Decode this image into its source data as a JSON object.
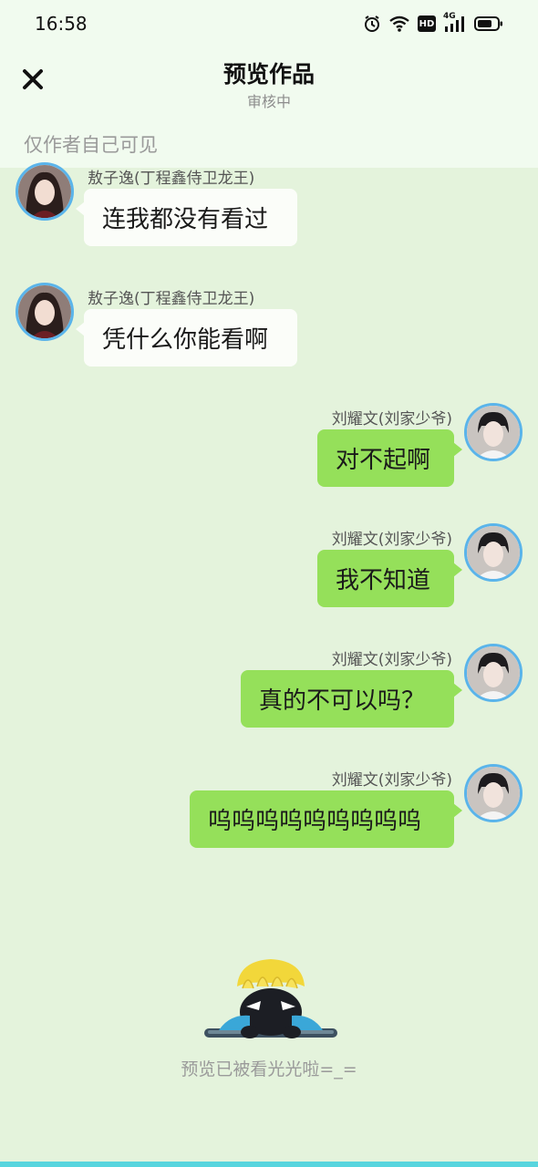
{
  "status_bar": {
    "time": "16:58",
    "icons": [
      "alarm-icon",
      "wifi-icon",
      "hd-icon",
      "signal-4g-icon",
      "battery-icon"
    ],
    "hd_label": "HD",
    "network_label": "4G"
  },
  "header": {
    "title": "预览作品",
    "subtitle": "审核中",
    "close_icon": "close-icon"
  },
  "visibility_note": "仅作者自己可见",
  "messages": [
    {
      "side": "left",
      "sender": "敖子逸(丁程鑫侍卫龙王)",
      "text": "连我都没有看过"
    },
    {
      "side": "left",
      "sender": "敖子逸(丁程鑫侍卫龙王)",
      "text": "凭什么你能看啊"
    },
    {
      "side": "right",
      "sender": "刘耀文(刘家少爷)",
      "text": "对不起啊"
    },
    {
      "side": "right",
      "sender": "刘耀文(刘家少爷)",
      "text": "我不知道"
    },
    {
      "side": "right",
      "sender": "刘耀文(刘家少爷)",
      "text": "真的不可以吗？"
    },
    {
      "side": "right",
      "sender": "刘耀文(刘家少爷)",
      "text": "呜呜呜呜呜呜呜呜呜"
    }
  ],
  "footer": {
    "end_text": "预览已被看光光啦=_="
  },
  "colors": {
    "background": "#e4f3dc",
    "header_bg": "#f1fbef",
    "left_bubble": "#fbfdf9",
    "right_bubble": "#95e05a",
    "avatar_ring": "#5ab4ea",
    "bottom_accent": "#58d5de"
  }
}
